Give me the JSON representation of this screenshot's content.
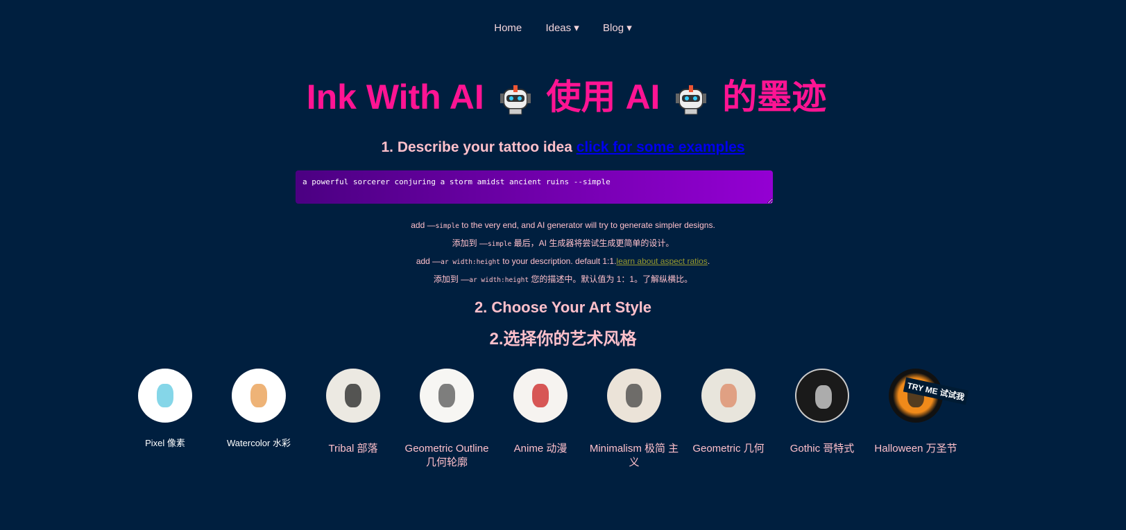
{
  "nav": {
    "items": [
      "Home",
      "Ideas ▾",
      "Blog ▾"
    ]
  },
  "title": {
    "part1": "Ink With AI",
    "part2": "使用 AI",
    "part3": "的墨迹"
  },
  "step1": {
    "heading": "1. Describe your tattoo idea",
    "link": "click for some examples"
  },
  "prompt": {
    "value": "a powerful sorcerer conjuring a storm amidst ancient ruins --simple"
  },
  "hints": {
    "l1a": "add —",
    "l1code": "simple",
    "l1b": " to the very end, and AI generator will try to generate simpler designs.",
    "l2a": "添加到 —",
    "l2code": "simple",
    "l2b": " 最后，AI 生成器将尝试生成更简单的设计。",
    "l3a": "add —",
    "l3code": "ar width:height",
    "l3b": " to your description. default 1:1.",
    "l3link": "learn about aspect ratios",
    "l3c": ".",
    "l4a": "添加到 —",
    "l4code": "ar width:height",
    "l4b": " 您的描述中。默认值为 1：1。了解纵横比。"
  },
  "step2": {
    "heading_en": "2. Choose Your Art Style",
    "heading_zh": "2.选择你的艺术风格"
  },
  "styles": [
    {
      "label": "Pixel 像素",
      "bg": "#ffffff"
    },
    {
      "label": "Watercolor 水彩",
      "bg": "#ffffff"
    },
    {
      "label": "Tribal 部落",
      "bg": "#ece9e2"
    },
    {
      "label": "Geometric Outline 几何轮廓",
      "bg": "#f7f6f3"
    },
    {
      "label": "Anime 动漫",
      "bg": "#f6f3f0"
    },
    {
      "label": "Minimalism 极简 主义",
      "bg": "#ebe3d8"
    },
    {
      "label": "Geometric 几何",
      "bg": "#e8e5dc"
    },
    {
      "label": "Gothic 哥特式",
      "bg": "#1a1a1a"
    },
    {
      "label": "Halloween 万圣节",
      "bg": "#111111",
      "badge": "TRY ME 试试我"
    }
  ],
  "colors": {
    "background": "#001f3f",
    "title": "#ff1493",
    "text": "#ffc0cb"
  }
}
